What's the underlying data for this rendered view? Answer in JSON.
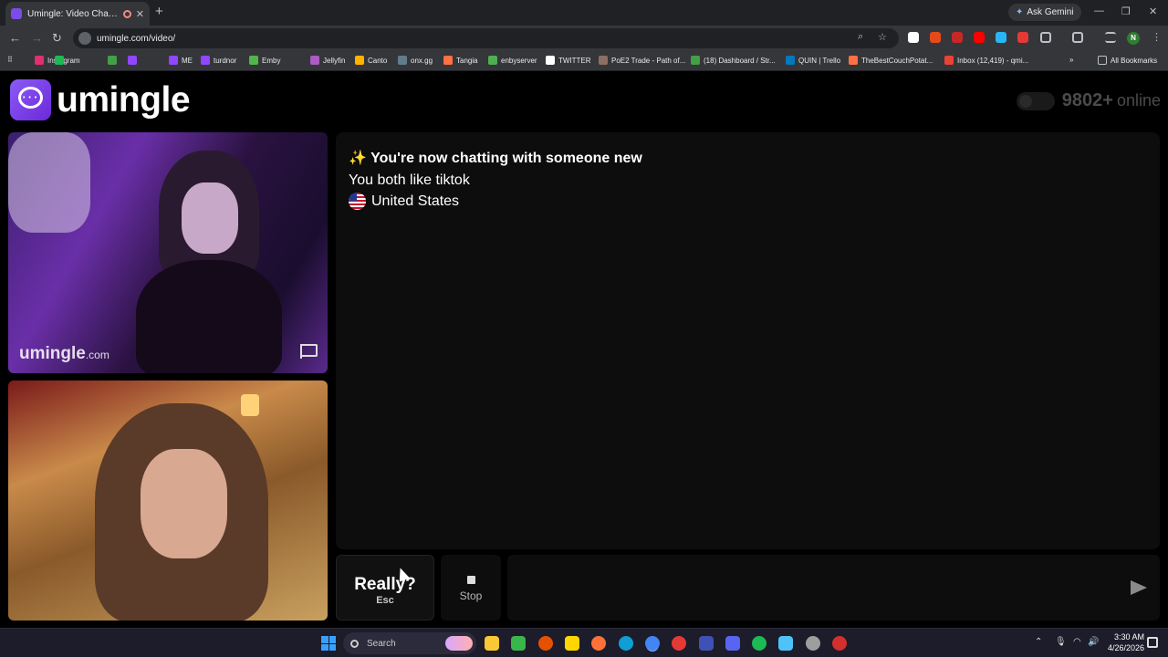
{
  "browser": {
    "tab_title": "Umingle: Video Chat with S",
    "tab_close": "✕",
    "new_tab": "+",
    "ask_gemini": "Ask Gemini",
    "url": "umingle.com/video/",
    "window_min": "—",
    "window_max": "❐",
    "window_close": "✕",
    "profile_initial": "N",
    "bookmarks": [
      {
        "label": "Instagram",
        "color": "#e1306c"
      },
      {
        "label": "",
        "color": "#1db954"
      },
      {
        "label": "",
        "color": "#43a047"
      },
      {
        "label": "",
        "color": "#9146ff"
      },
      {
        "label": "ME",
        "color": "#9146ff"
      },
      {
        "label": "turdnor",
        "color": "#9146ff"
      },
      {
        "label": "Emby",
        "color": "#52b54b"
      },
      {
        "label": "Jellyfin",
        "color": "#aa5cc3"
      },
      {
        "label": "Canto",
        "color": "#ffb300"
      },
      {
        "label": "onx.gg",
        "color": "#607d8b"
      },
      {
        "label": "Tangia",
        "color": "#ff7043"
      },
      {
        "label": "enbyserver",
        "color": "#4caf50"
      },
      {
        "label": "TWITTER",
        "color": "#ffffff"
      },
      {
        "label": "PoE2 Trade - Path of...",
        "color": "#8d6e63"
      },
      {
        "label": "(18) Dashboard / Str...",
        "color": "#43a047"
      },
      {
        "label": "QUIN | Trello",
        "color": "#0079bf"
      },
      {
        "label": "TheBestCouchPotat...",
        "color": "#ff7043"
      },
      {
        "label": "Inbox (12,419) - qmi...",
        "color": "#ea4335"
      }
    ],
    "all_bookmarks": "All Bookmarks"
  },
  "site": {
    "logo_text": "umingle",
    "online_count": "9802+",
    "online_label": "online"
  },
  "video": {
    "watermark_main": "umingle",
    "watermark_suffix": ".com"
  },
  "chat": {
    "header_emoji": "✨",
    "header": "You're now chatting with someone new",
    "interests": "You both like tiktok",
    "country": "United States"
  },
  "controls": {
    "really_label": "Really?",
    "really_key": "Esc",
    "stop_label": "Stop",
    "message_placeholder": ""
  },
  "taskbar": {
    "search_label": "Search",
    "time": "3:30 AM",
    "date": "4/26/2026"
  }
}
